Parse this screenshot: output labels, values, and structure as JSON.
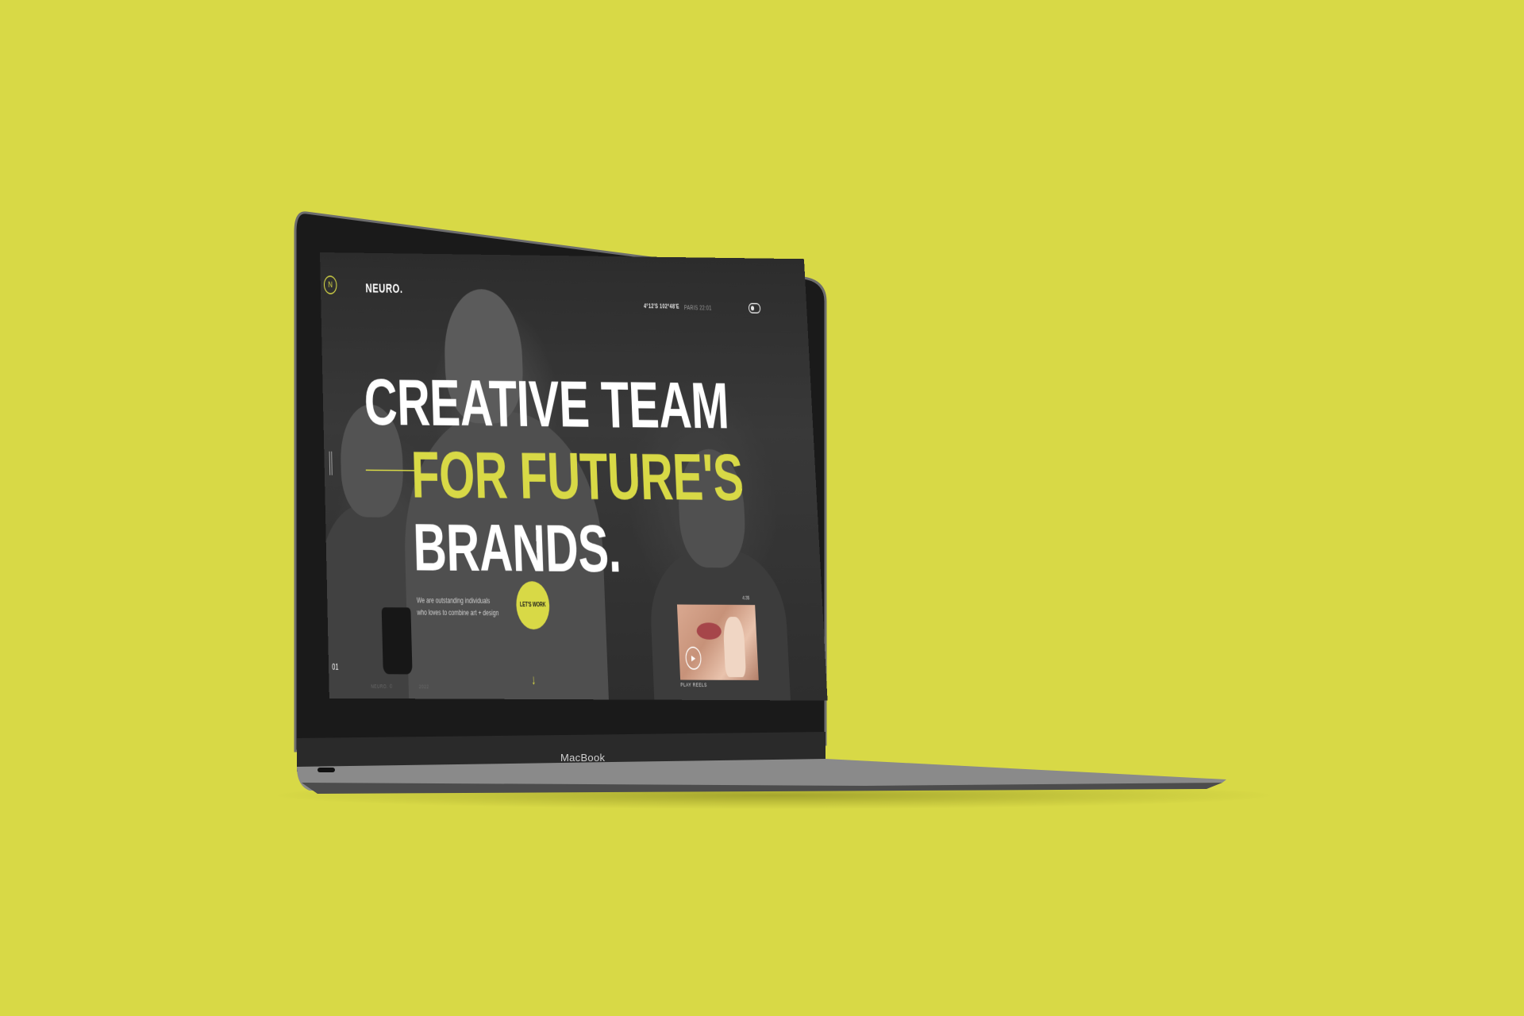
{
  "background_color": "#D8D946",
  "device": {
    "bezel_label": "MacBook"
  },
  "site": {
    "logo_mark": "N",
    "brand": "NEURO.",
    "coordinates": "4°12'S 102°48'E",
    "clock": "PARIS 22:01",
    "toggle_icon": "theme-toggle-icon",
    "headline_line1": "CREATIVE TEAM",
    "headline_line2": "FOR FUTURE'S",
    "headline_line3": "BRANDS.",
    "tagline_line1": "We are outstanding individuals",
    "tagline_line2": "who loves to combine art + design",
    "cta_label": "LET'S WORK",
    "slide_number": "01",
    "footer_left": "NEURO. ©",
    "footer_right": "2022",
    "reel_duration": "4:35",
    "reel_label": "PLAY REELS",
    "accent_color": "#D8D946"
  }
}
